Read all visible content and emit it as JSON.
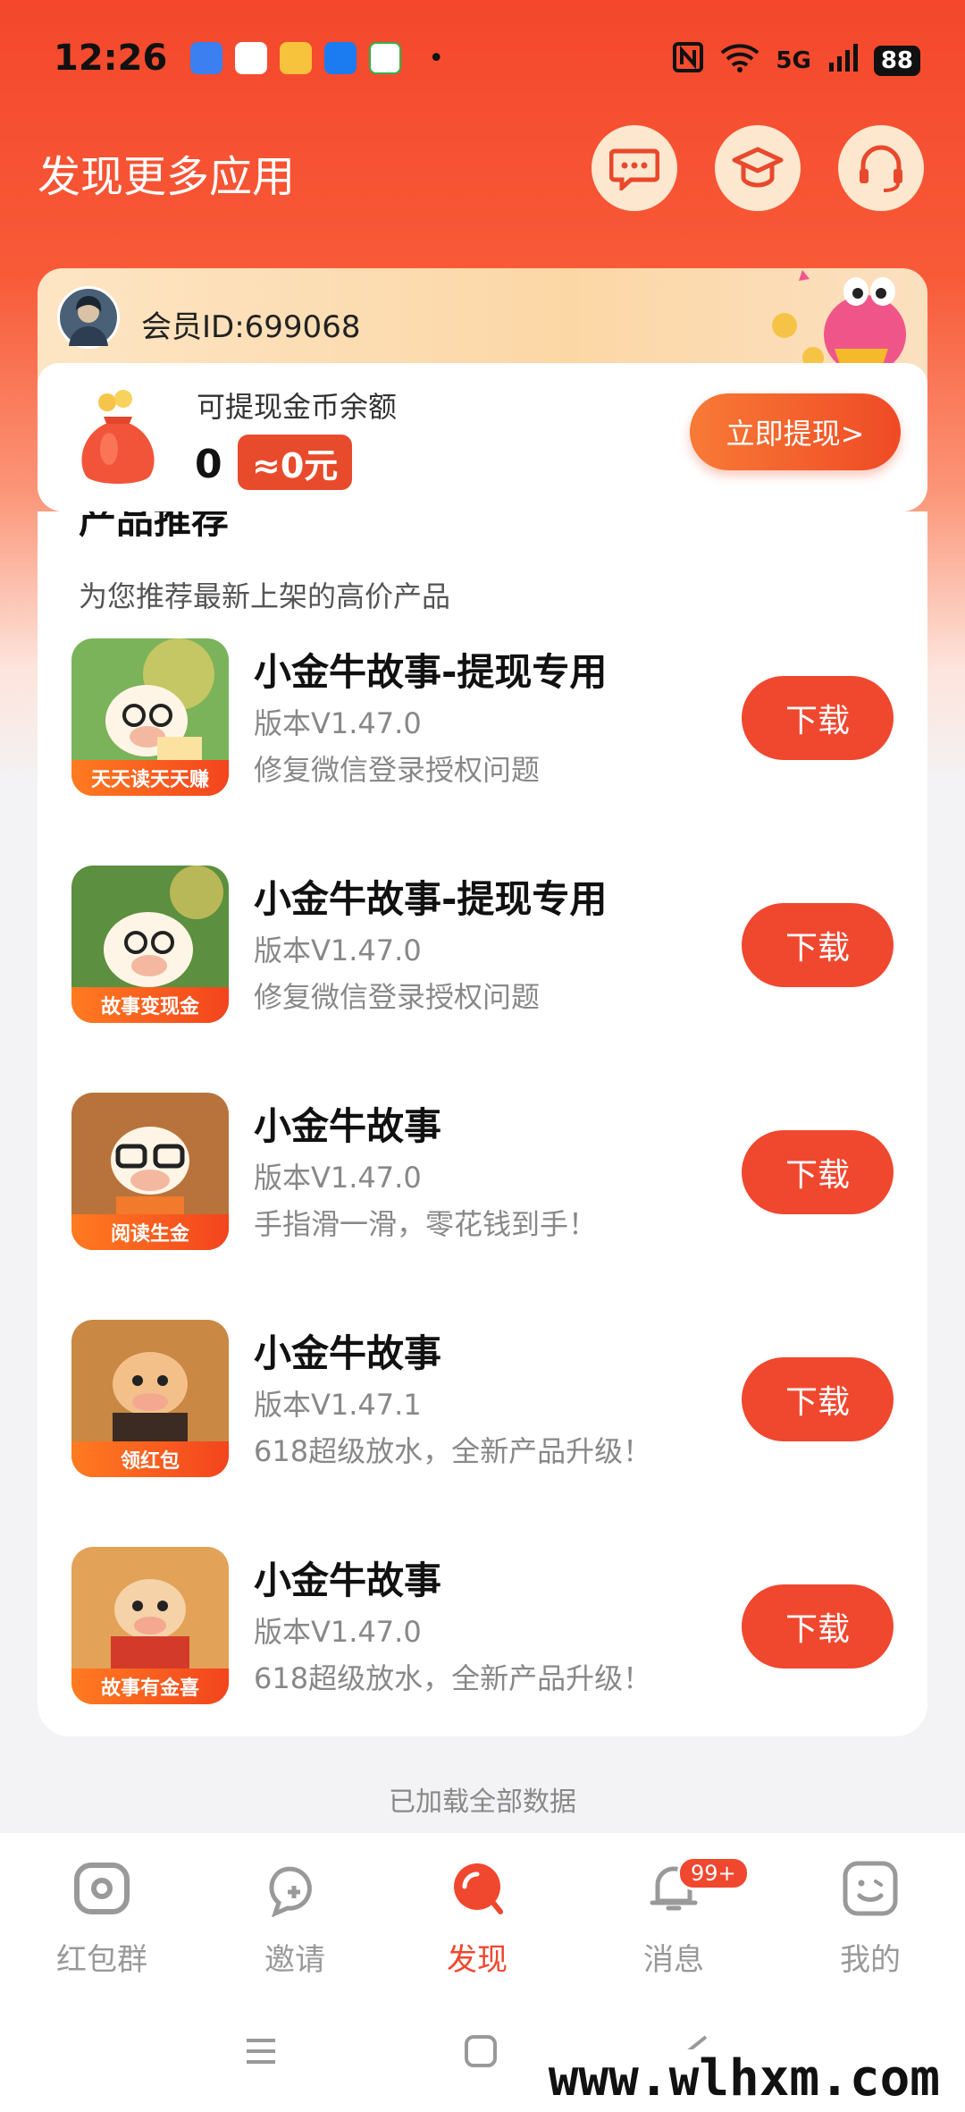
{
  "status_bar": {
    "time": "12:26",
    "network": "5G",
    "battery": "88"
  },
  "header": {
    "title": "发现更多应用"
  },
  "member": {
    "id_label": "会员ID:699068",
    "balance_label": "可提现金币余额",
    "balance_amount": "0",
    "balance_rmb": "≈0元",
    "withdraw_label": "立即提现>"
  },
  "products": {
    "title": "产品推荐",
    "subtitle": "为您推荐最新上架的高价产品",
    "download_label": "下载",
    "items": [
      {
        "name": "小金牛故事-提现专用",
        "version": "版本V1.47.0",
        "desc": "修复微信登录授权问题",
        "icon_banner": "天天读天天赚",
        "icon_bg": "#7bb35a"
      },
      {
        "name": "小金牛故事-提现专用",
        "version": "版本V1.47.0",
        "desc": "修复微信登录授权问题",
        "icon_banner": "故事变现金",
        "icon_bg": "#5c8f3f"
      },
      {
        "name": "小金牛故事",
        "version": "版本V1.47.0",
        "desc": "手指滑一滑，零花钱到手！",
        "icon_banner": "阅读生金",
        "icon_bg": "#b8733c"
      },
      {
        "name": "小金牛故事",
        "version": "版本V1.47.1",
        "desc": "618超级放水，全新产品升级！",
        "icon_banner": "领红包",
        "icon_bg": "#c98844"
      },
      {
        "name": "小金牛故事",
        "version": "版本V1.47.0",
        "desc": "618超级放水，全新产品升级！",
        "icon_banner": "故事有金喜",
        "icon_bg": "#e2a257"
      }
    ]
  },
  "footer": {
    "loaded_text": "已加载全部数据"
  },
  "tabs": [
    {
      "label": "红包群",
      "icon": "camera-icon"
    },
    {
      "label": "邀请",
      "icon": "chat-plus-icon"
    },
    {
      "label": "发现",
      "icon": "discover-icon"
    },
    {
      "label": "消息",
      "icon": "bell-icon",
      "badge": "99+"
    },
    {
      "label": "我的",
      "icon": "smile-face-icon"
    }
  ],
  "watermark": "www.wlhxm.com",
  "colors": {
    "brand_red": "#f0472f",
    "cream": "#fde7cf"
  }
}
